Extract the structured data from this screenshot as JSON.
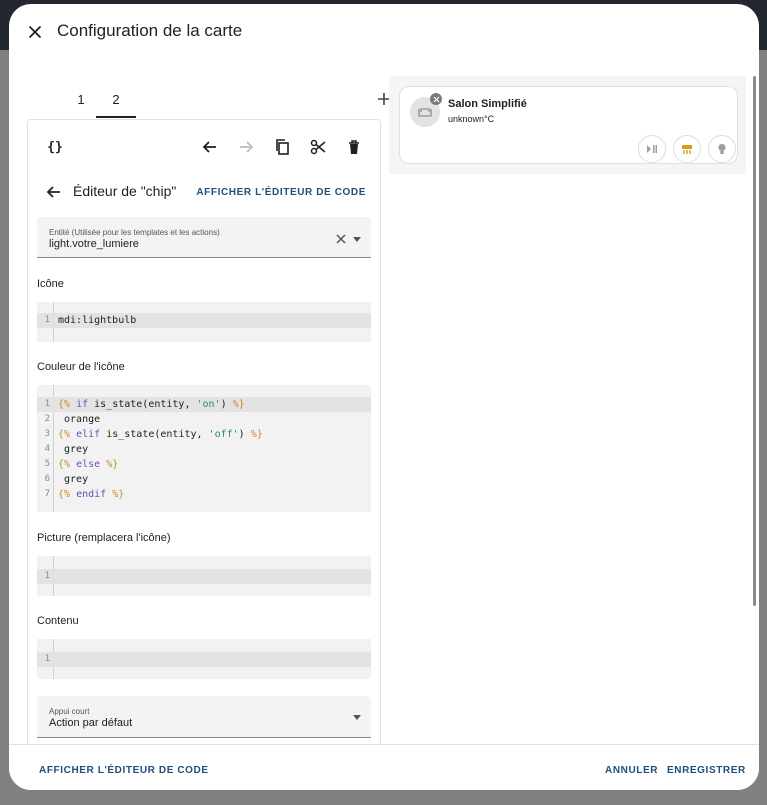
{
  "dialog": {
    "title": "Configuration de la carte"
  },
  "tabs": [
    {
      "label": "1",
      "active": false
    },
    {
      "label": "2",
      "active": true
    }
  ],
  "editor": {
    "code_toggle": "{}",
    "sub_title": "Éditeur de \"chip\"",
    "show_code_label": "AFFICHER L'ÉDITEUR DE CODE",
    "entity": {
      "label": "Entité (Utilisée pour les templates et les actions)",
      "value": "light.votre_lumiere"
    },
    "icon": {
      "label": "Icône",
      "lines": [
        "mdi:lightbulb"
      ]
    },
    "icon_color": {
      "label": "Couleur de l'icône",
      "lines": [
        "{% if is_state(entity, 'on') %}",
        " orange",
        "{% elif is_state(entity, 'off') %}",
        " grey",
        "{% else %}",
        " grey",
        "{% endif %}"
      ]
    },
    "picture": {
      "label": "Picture (remplacera l'icône)",
      "lines": [
        ""
      ]
    },
    "content": {
      "label": "Contenu",
      "lines": [
        ""
      ]
    },
    "tap": {
      "label": "Appui court",
      "value": "Action par défaut"
    }
  },
  "preview": {
    "title": "Salon Simplifié",
    "subtitle": "unknown°C",
    "chips": [
      "play-pause-icon",
      "heater-icon",
      "lightbulb-icon"
    ],
    "chip_accent": "#d4a017"
  },
  "footer": {
    "show_code_label": "AFFICHER L'ÉDITEUR DE CODE",
    "cancel_label": "ANNULER",
    "save_label": "ENREGISTRER"
  },
  "colors": {
    "accent": "#1f4e79",
    "template_tag": "#c98a2b",
    "keyword": "#6b4fbb",
    "string": "#2b8a6a"
  }
}
